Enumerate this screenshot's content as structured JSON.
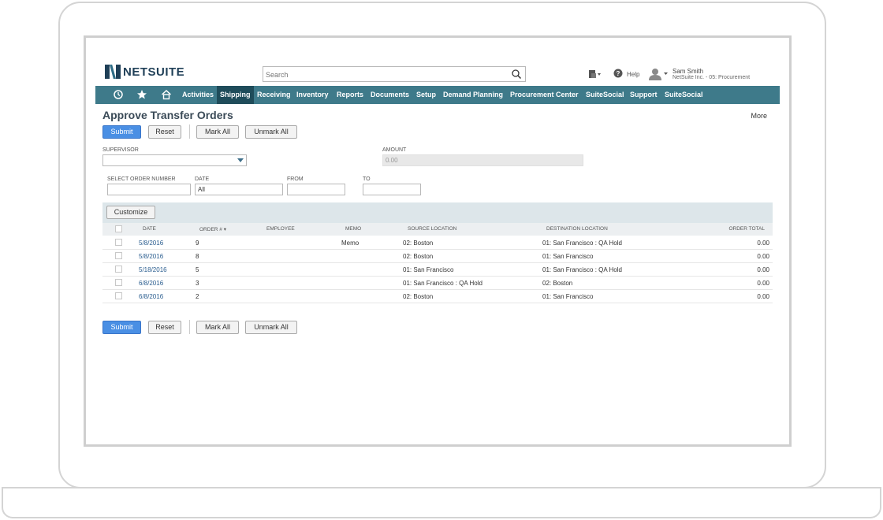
{
  "header": {
    "logo_text": "NETSUITE",
    "search_placeholder": "Search",
    "help_label": "Help",
    "user_name": "Sam Smith",
    "user_role": "NetSuite Inc. - 05: Procurement"
  },
  "nav": {
    "items": [
      "Activities",
      "Shipping",
      "Receiving",
      "Inventory",
      "Reports",
      "Documents",
      "Setup",
      "Demand Planning",
      "Procurement Center",
      "SuiteSocial",
      "Support",
      "SuiteSocial"
    ],
    "active": "Shipping"
  },
  "page": {
    "title": "Approve Transfer Orders",
    "more_label": "More"
  },
  "buttons": {
    "submit": "Submit",
    "reset": "Reset",
    "mark_all": "Mark All",
    "unmark_all": "Unmark All",
    "customize": "Customize"
  },
  "filters": {
    "supervisor_label": "Supervisor",
    "supervisor_value": "",
    "amount_label": "Amount",
    "amount_value": "0.00",
    "order_number_label": "Select Order Number",
    "order_number_value": "",
    "date_label": "Date",
    "date_value": "All",
    "from_label": "From",
    "from_value": "",
    "to_label": "To",
    "to_value": ""
  },
  "table": {
    "columns": [
      "Date",
      "Order # ▾",
      "Employee",
      "Memo",
      "Source Location",
      "Destination Location",
      "Order Total"
    ],
    "rows": [
      {
        "date": "5/8/2016",
        "order": "9",
        "employee": "",
        "memo": "Memo",
        "source": "02: Boston",
        "destination": "01: San Francisco : QA Hold",
        "total": "0.00"
      },
      {
        "date": "5/8/2016",
        "order": "8",
        "employee": "",
        "memo": "",
        "source": "02: Boston",
        "destination": "01: San Francisco",
        "total": "0.00"
      },
      {
        "date": "5/18/2016",
        "order": "5",
        "employee": "",
        "memo": "",
        "source": "01: San Francisco",
        "destination": "01: San Francisco : QA Hold",
        "total": "0.00"
      },
      {
        "date": "6/8/2016",
        "order": "3",
        "employee": "",
        "memo": "",
        "source": "01: San Francisco : QA Hold",
        "destination": "02: Boston",
        "total": "0.00"
      },
      {
        "date": "6/8/2016",
        "order": "2",
        "employee": "",
        "memo": "",
        "source": "02: Boston",
        "destination": "01: San Francisco",
        "total": "0.00"
      }
    ]
  },
  "colors": {
    "nav_bg": "#3e7a8a",
    "nav_active": "#1f4c5a",
    "primary_button": "#4a8fe4",
    "link": "#2a5d8f",
    "title": "#3a4a57"
  }
}
